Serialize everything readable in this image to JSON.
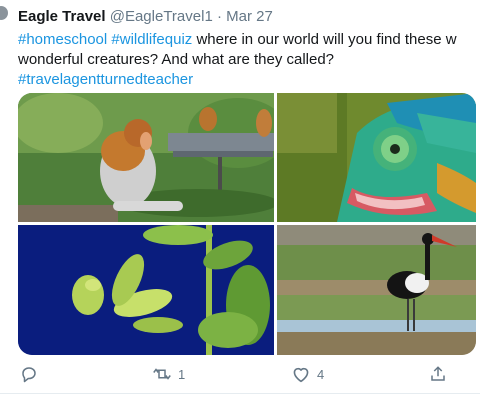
{
  "tweet": {
    "display_name": "Eagle Travel",
    "handle": "@EagleTravel1",
    "separator": "·",
    "date": "Mar 27",
    "text_line1": [
      {
        "text": "#homeschool",
        "type": "hashtag"
      },
      {
        "text": " ",
        "type": "text"
      },
      {
        "text": "#wildlifequiz",
        "type": "hashtag"
      },
      {
        "text": " where in our world will you find these w",
        "type": "text"
      }
    ],
    "text_line2": "wonderful creatures? And what are they called?",
    "text_line3_hashtag": "#travelagentturnedteacher",
    "media": [
      {
        "name": "photo-proboscis-monkey"
      },
      {
        "name": "photo-chameleon"
      },
      {
        "name": "photo-praying-mantis"
      },
      {
        "name": "photo-saddle-billed-stork"
      }
    ],
    "actions": {
      "reply_count": "",
      "retweet_count": "1",
      "like_count": "4"
    }
  },
  "colors": {
    "hashtag": "#1b95e0",
    "secondary_text": "#657786",
    "action_icon": "#657786"
  },
  "icons": [
    "reply-icon",
    "retweet-icon",
    "like-icon",
    "share-icon"
  ]
}
